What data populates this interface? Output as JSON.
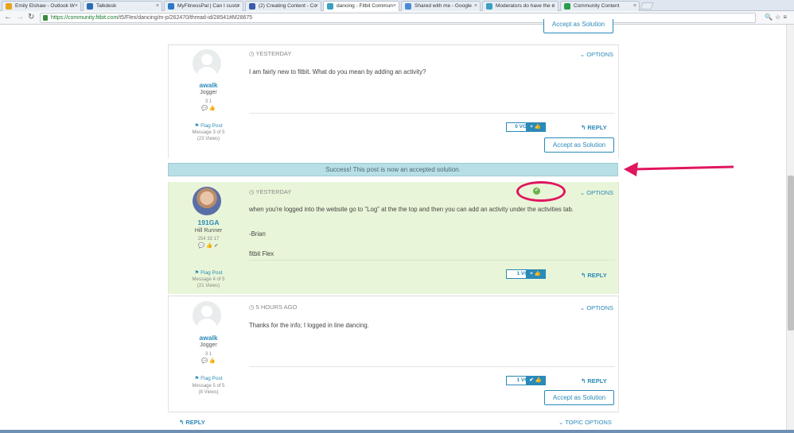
{
  "browser": {
    "tabs": [
      {
        "label": "Emily Elshaw - Outlook W",
        "color": "#e8a317"
      },
      {
        "label": "Talkdesk",
        "color": "#2b6cb0"
      },
      {
        "label": "MyFitnessPal | Can I custo",
        "color": "#2a78c8"
      },
      {
        "label": "(2) Creating Content - Co",
        "color": "#3a5ca8"
      },
      {
        "label": "dancing - Fitbit Commun",
        "color": "#3aa0c0"
      },
      {
        "label": "Shared with me - Google",
        "color": "#4a8ad8"
      },
      {
        "label": "Moderators do have the c",
        "color": "#3aa0c0"
      },
      {
        "label": "Community Content",
        "color": "#2a9d4a"
      }
    ],
    "url_host": "https://community.fitbit.com",
    "url_path": "/t5/Flex/dancing/m-p/262470/thread-id/28541#M28675"
  },
  "top_accept_label": "Accept as Solution",
  "posts": [
    {
      "username": "awalk",
      "rank": "Jogger",
      "stats": "3     1",
      "timestamp": "YESTERDAY",
      "options": "OPTIONS",
      "body": [
        "I am fairly new to fitbit. What do you mean by adding an activity?"
      ],
      "flag": "Flag Post",
      "message_info": "Message 3 of 5",
      "views": "(23 Views)",
      "votes": "0 VOTES",
      "reply": "REPLY",
      "accept": "Accept as Solution"
    },
    {
      "username": "191GA",
      "rank": "Hill Runner",
      "stats": "254   33   17",
      "timestamp": "YESTERDAY",
      "options": "OPTIONS",
      "body": [
        "when you're logged into the website go to \"Log\" at the the top and then you can add an activity under the activities tab.",
        "-Brian",
        "fitbit Flex"
      ],
      "flag": "Flag Post",
      "message_info": "Message 4 of 5",
      "views": "(21 Views)",
      "votes": "1 VOTE",
      "reply": "REPLY"
    },
    {
      "username": "awalk",
      "rank": "Jogger",
      "stats": "3     1",
      "timestamp": "5 HOURS AGO",
      "options": "OPTIONS",
      "body": [
        "Thanks for the info; I logged in line dancing."
      ],
      "flag": "Flag Post",
      "message_info": "Message 5 of 5",
      "views": "(8 Views)",
      "votes": "1 VOTE",
      "reply": "REPLY",
      "accept": "Accept as Solution"
    }
  ],
  "banner": "Success! This post is now an accepted solution.",
  "bottom": {
    "reply": "REPLY",
    "topic_options": "TOPIC OPTIONS"
  },
  "colors": {
    "link": "#2a8ab8",
    "accepted_bg": "#e9f5d8",
    "banner_bg": "#b9dfe6",
    "annotation": "#e0165f"
  }
}
